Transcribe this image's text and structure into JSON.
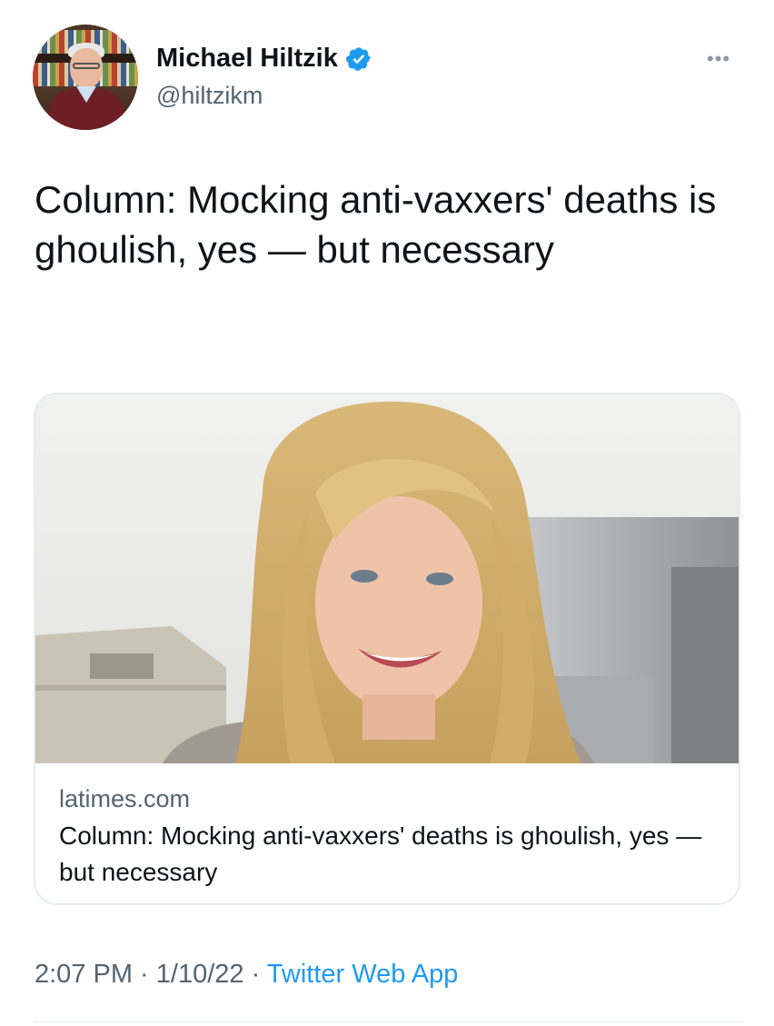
{
  "author": {
    "name": "Michael Hiltzik",
    "handle": "@hiltzikm",
    "verified": true
  },
  "more_icon": "more-horizontal-icon",
  "tweet": {
    "text": "Column: Mocking anti-vaxxers' deaths is ghoulish, yes — but necessary"
  },
  "card": {
    "domain": "latimes.com",
    "title": "Column: Mocking anti-vaxxers' deaths is ghoulish, yes — but necessary"
  },
  "meta": {
    "time": "2:07 PM",
    "date": "1/10/22",
    "source": "Twitter Web App",
    "separator": " · "
  },
  "colors": {
    "text": "#0f1419",
    "secondary": "#536471",
    "accent": "#1d9bf0",
    "border": "#e6ebef"
  }
}
